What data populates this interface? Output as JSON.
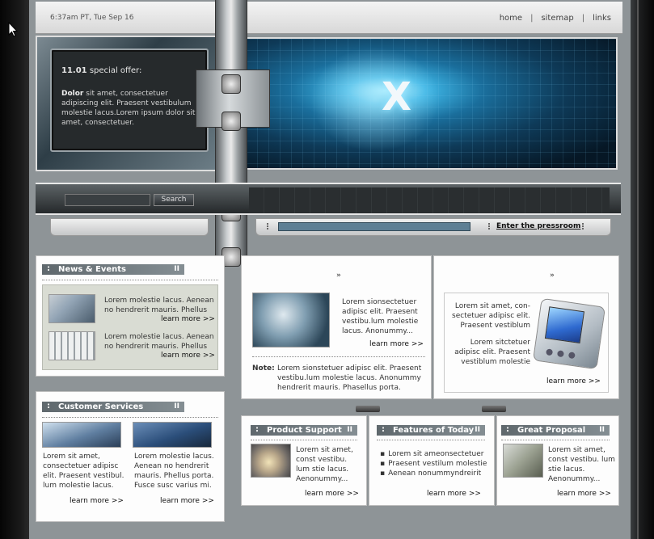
{
  "header": {
    "datetime": "6:37am PT, Tue Sep 16",
    "nav": [
      "home",
      "sitemap",
      "links"
    ],
    "separator": "|"
  },
  "offer": {
    "number": "11.01",
    "label": "special offer:",
    "lead": "Dolor",
    "text": "sit amet, consectetuer adipiscing elit. Praesent vestibulum molestie lacus.Lorem ipsum dolor sit amet, consectetuer."
  },
  "search": {
    "button": "Search",
    "placeholder": ""
  },
  "pressroom": {
    "link": "Enter the pressroom"
  },
  "news": {
    "title": "News & Events",
    "pipe": "II",
    "items": [
      {
        "text": "Lorem molestie lacus. Aenean no hendrerit mauris. Phellus",
        "more": "learn more >>"
      },
      {
        "text": "Lorem molestie lacus. Aenean no hendrerit mauris. Phellus",
        "more": "learn more >>"
      }
    ]
  },
  "customer": {
    "title": "Customer Services",
    "pipe": "II",
    "cols": [
      {
        "text": "Lorem sit amet, consectetuer adipisc elit. Praesent vestibul. lum molestie lacus.",
        "more": "learn more >>"
      },
      {
        "text": "Lorem molestie lacus. Aenean no hendrerit mauris. Phellus porta. Fusce susc varius mi.",
        "more": "learn more >>"
      }
    ]
  },
  "center": {
    "arrow": "»",
    "text": "Lorem sionsectetuer adipisc elit. Praesent vestibu.lum molestie lacus. Anonummy...",
    "more": "learn more >>",
    "note_label": "Note:",
    "note_text": "Lorem sionstetuer adipisc elit. Praesent vestibu.lum molestie lacus. Anonummy hendrerit mauris. Phasellus porta."
  },
  "right": {
    "arrow": "»",
    "line1": "Lorem sit amet, con- sectetuer adipisc elit. Praesent vestiblum",
    "line2": "Lorem sitctetuer adipisc elit. Praesent vestiblum molestie",
    "more": "learn more >>"
  },
  "bottom": {
    "product": {
      "title": "Product Support",
      "pipe": "II",
      "text": "Lorem sit amet, const vestibu. lum stie lacus. Aenonummy...",
      "more": "learn more >>"
    },
    "features": {
      "title": "Features of Today",
      "pipe": "II",
      "items": [
        "Lorem sit ameonsectetuer",
        "Praesent vestilum molestie",
        "Aenean nonummyndreirit"
      ],
      "more": "learn more >>"
    },
    "proposal": {
      "title": "Great Proposal",
      "pipe": "II",
      "text": "Lorem sit amet, const vestibu. lum stie lacus. Aenonummy...",
      "more": "learn more >>"
    }
  },
  "hero": {
    "logo": "X"
  }
}
